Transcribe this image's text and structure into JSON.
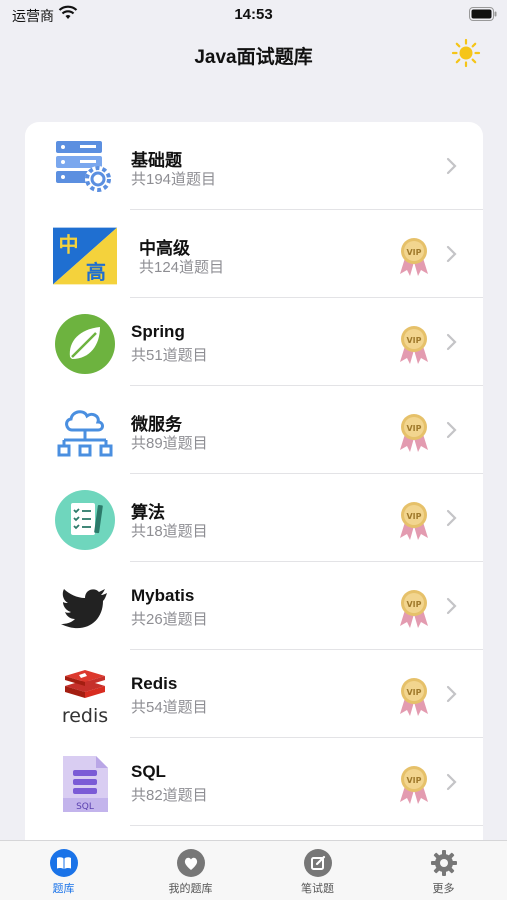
{
  "status_bar": {
    "carrier": "运营商",
    "time": "14:53"
  },
  "nav": {
    "title": "Java面试题库",
    "theme_icon": "sun-icon"
  },
  "categories": [
    {
      "name": "基础题",
      "count": "共194道题目",
      "icon": "server-gear-icon",
      "vip": false
    },
    {
      "name": "中高级",
      "count": "共124道题目",
      "icon": "zhonggao-badge-icon",
      "vip": true
    },
    {
      "name": "Spring",
      "count": "共51道题目",
      "icon": "spring-leaf-icon",
      "vip": true
    },
    {
      "name": "微服务",
      "count": "共89道题目",
      "icon": "cloud-network-icon",
      "vip": true
    },
    {
      "name": "算法",
      "count": "共18道题目",
      "icon": "checklist-icon",
      "vip": true
    },
    {
      "name": "Mybatis",
      "count": "共26道题目",
      "icon": "bird-icon",
      "vip": true
    },
    {
      "name": "Redis",
      "count": "共54道题目",
      "icon": "redis-logo-icon",
      "vip": true
    },
    {
      "name": "SQL",
      "count": "共82道题目",
      "icon": "sql-file-icon",
      "vip": true
    }
  ],
  "tabs": [
    {
      "label": "题库",
      "icon": "book-icon",
      "active": true
    },
    {
      "label": "我的题库",
      "icon": "heart-icon",
      "active": false
    },
    {
      "label": "笔试题",
      "icon": "edit-icon",
      "active": false
    },
    {
      "label": "更多",
      "icon": "gear-icon",
      "active": false
    }
  ],
  "colors": {
    "accent": "#1a73e8",
    "background": "#efeff4",
    "vip_gold": "#e6c16a",
    "vip_ribbon": "#e39bb0"
  }
}
